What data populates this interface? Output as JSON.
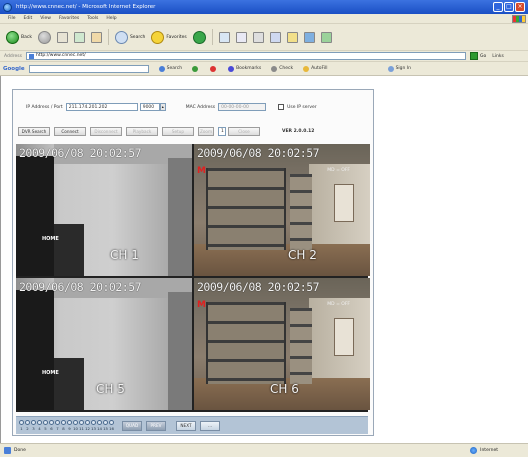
{
  "browser": {
    "title": "http://www.cnnec.net/ - Microsoft Internet Explorer",
    "menu": [
      "File",
      "Edit",
      "View",
      "Favorites",
      "Tools",
      "Help"
    ],
    "toolbar": {
      "back_label": "Back",
      "search_label": "Search",
      "favorites_label": "Favorites"
    },
    "address": {
      "label": "Address",
      "url": "http://www.cnnec.net/",
      "go_label": "Go",
      "links_label": "Links"
    },
    "googlebar": {
      "logo": "Google",
      "search_label": "Search",
      "bookmarks_label": "Bookmarks",
      "check_label": "Check",
      "autofill_label": "AutoFill",
      "signin_label": "Sign In"
    },
    "status": {
      "text": "Done",
      "zone": "Internet"
    }
  },
  "dvr": {
    "ip_label": "IP Address / Port",
    "ip_value": "211.174.201.202",
    "port_value": "9000",
    "mac_label": "MAC Address",
    "mac_placeholder": "00-00-00-00",
    "use_ip_label": "Use IP server",
    "buttons": {
      "search": "DVR Search",
      "connect": "Connect",
      "disconnect": "Disconnect",
      "playback": "Playback",
      "setup": "Setup",
      "zoom": "Zoom",
      "page_value": "1",
      "close": "Close"
    },
    "version": "VER 2.0.0.12",
    "cameras": [
      {
        "timestamp": "2009/06/08  20:02:57",
        "channel": "CH 1",
        "overlay": "HOME"
      },
      {
        "timestamp": "2009/06/08  20:02:57",
        "channel": "CH 2",
        "overlay": "M",
        "motion": "MD = OFF"
      },
      {
        "timestamp": "2009/06/08  20:02:57",
        "channel": "CH 5",
        "overlay": "HOME"
      },
      {
        "timestamp": "2009/06/08  20:02:57",
        "channel": "CH 6",
        "overlay": "M",
        "motion": "MD = OFF"
      }
    ],
    "channel_numbers": [
      "1",
      "2",
      "3",
      "4",
      "5",
      "6",
      "7",
      "8",
      "9",
      "10",
      "11",
      "12",
      "13",
      "14",
      "15",
      "16"
    ],
    "bottom_buttons": {
      "quad": "QUAD",
      "prev": "PREV",
      "next": "NEXT",
      "extra": "..."
    }
  }
}
